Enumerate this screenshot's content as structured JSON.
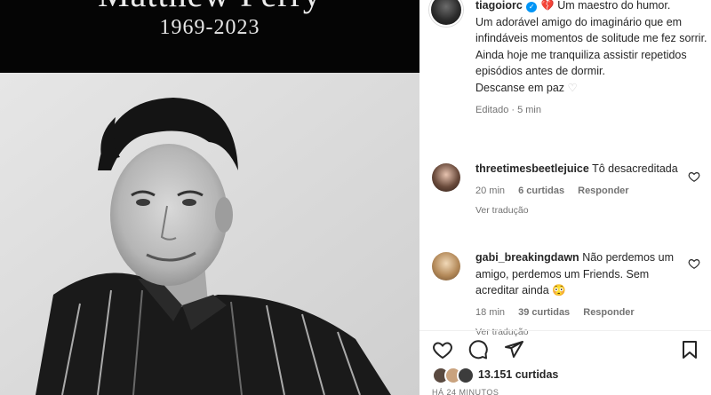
{
  "media": {
    "banner_name": "Matthew Perry",
    "banner_years": "1969-2023"
  },
  "post": {
    "username": "tiagoiorc",
    "caption_first": "Um maestro do humor.",
    "caption_lines": [
      "Um adorável amigo do imaginário que em infindáveis momentos de solitude me fez sorrir.",
      "Ainda hoje me tranquiliza assistir repetidos episódios antes de dormir.",
      "Descanse em paz"
    ],
    "edited": "Editado",
    "edited_time": "5 min"
  },
  "comments": [
    {
      "username": "threetimesbeetlejuice",
      "text": "Tô desacreditada",
      "time": "20 min",
      "likes": "6 curtidas",
      "reply": "Responder",
      "translate": "Ver tradução"
    },
    {
      "username": "gabi_breakingdawn",
      "text": "Não perdemos um amigo, perdemos um Friends. Sem acreditar ainda",
      "emoji": "😳",
      "time": "18 min",
      "likes": "39 curtidas",
      "reply": "Responder",
      "translate": "Ver tradução"
    }
  ],
  "footer": {
    "likes_count": "13.151",
    "likes_word": "curtidas",
    "time_ago": "HÁ 24 MINUTOS"
  },
  "icons": {
    "verified": "verified-badge-icon",
    "broken_heart": "broken-heart-icon",
    "like": "heart-icon",
    "comment": "comment-icon",
    "share": "share-icon",
    "save": "bookmark-icon"
  },
  "colors": {
    "verified": "#0095f6",
    "broken_heart": "#ed4956",
    "secondary_text": "#737373"
  }
}
